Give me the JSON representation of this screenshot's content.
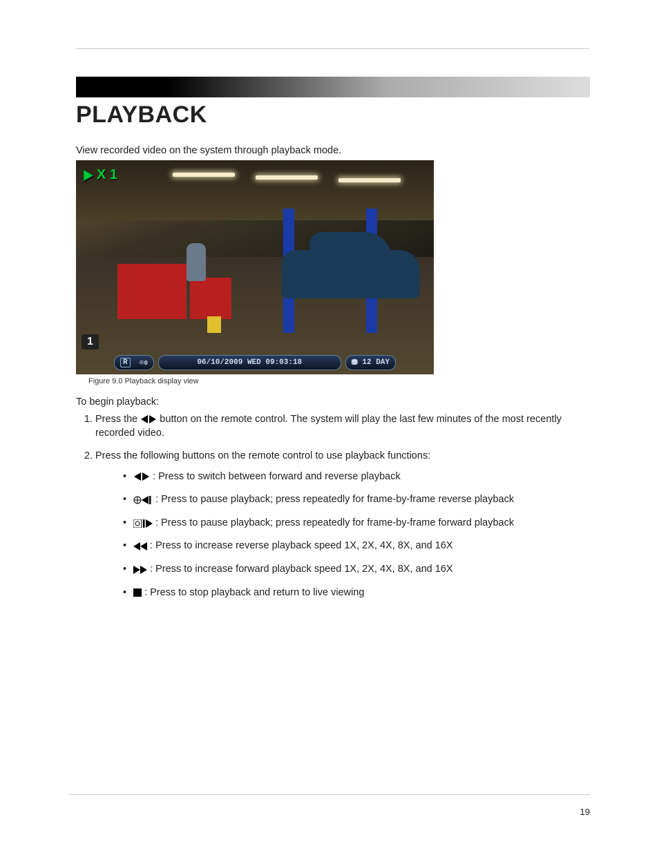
{
  "title": "PLAYBACK",
  "intro": "View recorded video on the system through playback mode.",
  "screenshot": {
    "speed_indicator": "X 1",
    "channel_badge": "1",
    "rec_indicator": "R",
    "motion_indicator": "0",
    "timestamp": "06/10/2009  WED  09:03:18",
    "hdd_status": "12 DAY"
  },
  "figure_caption": "Figure 9.0 Playback display view",
  "subhead": "To begin playback:",
  "steps": [
    {
      "pre": "Press the ",
      "post": " button on the remote control. The system will play the last few minutes of the most recently recorded video."
    },
    {
      "pre": "Press the following buttons on the remote control to use playback functions:",
      "post": ""
    }
  ],
  "functions": [
    ": Press to switch between forward and reverse playback",
    ": Press to pause playback; press repeatedly for frame-by-frame reverse playback",
    ": Press to pause playback; press repeatedly for frame-by-frame forward playback",
    ": Press to increase reverse playback speed 1X, 2X, 4X, 8X, and 16X",
    ": Press to increase forward playback speed 1X, 2X, 4X, 8X, and 16X",
    ": Press to stop playback and return to live viewing"
  ],
  "page_number": "19"
}
